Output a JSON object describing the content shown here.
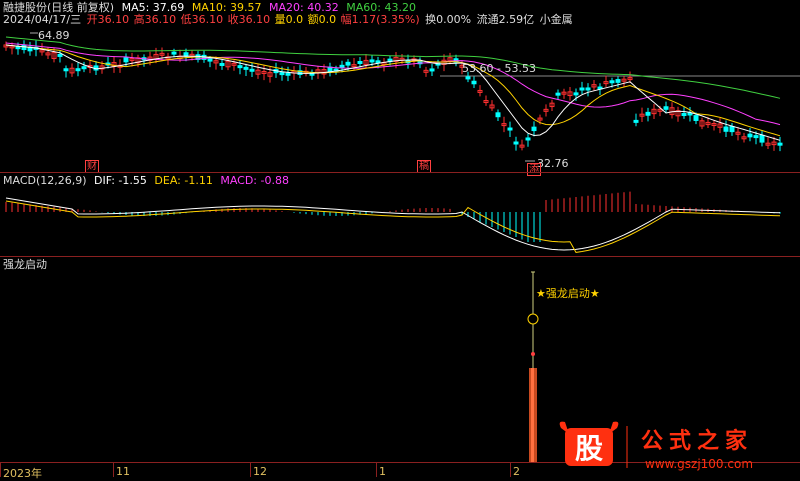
{
  "header_k": {
    "title": "融捷股份(日线 前复权)",
    "ma5": "MA5: 37.69",
    "ma10": "MA10: 39.57",
    "ma20": "MA20: 40.32",
    "ma60": "MA60: 43.20",
    "date": "2024/04/17/三",
    "open": "开36.10",
    "high": "高36.10",
    "low": "低36.10",
    "close": "收36.10",
    "vol": "量0.0",
    "amount": "额0.0",
    "change": "幅1.17(3.35%)",
    "turnover": "换0.00%",
    "float": "流通2.59亿",
    "sector": "小金属"
  },
  "annotations": {
    "high_price": "64.89",
    "range_label": "53.60 - 53.53",
    "low_price": "32.76",
    "tag_cai": "财",
    "tag_zhao": "稿",
    "tag_jiao": "添"
  },
  "header_macd": {
    "name": "MACD(12,26,9)",
    "dif": "DIF: -1.55",
    "dea": "DEA: -1.11",
    "macd": "MACD: -0.88"
  },
  "header_ind": {
    "name": "强龙启动",
    "signal": "★强龙启动★"
  },
  "xaxis": [
    "2023年",
    "11",
    "12",
    "1",
    "2"
  ],
  "watermark": {
    "logo": "股",
    "title": "公式之家",
    "url": "www.gszj100.com"
  },
  "colors": {
    "ma5": "#ffffff",
    "ma10": "#ffd200",
    "ma20": "#ff40ff",
    "ma60": "#40d040",
    "up": "#ff3030",
    "down": "#00ffff",
    "separator": "#8a2020"
  }
}
